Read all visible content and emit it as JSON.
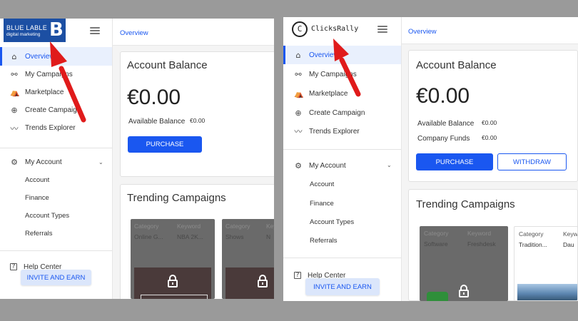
{
  "left": {
    "logo": {
      "line1": "BLUE LABLE",
      "line2": "digital marketing",
      "mark": "B"
    },
    "breadcrumb": "Overview",
    "nav": [
      "Overview",
      "My Campaigns",
      "Marketplace",
      "Create Campaign",
      "Trends Explorer"
    ],
    "account": {
      "label": "My Account",
      "items": [
        "Account",
        "Finance",
        "Account Types",
        "Referrals"
      ]
    },
    "help": "Help Center",
    "invite": "INVITE AND EARN",
    "balance_card": {
      "title": "Account Balance",
      "amount": "€0.00",
      "available_label": "Available Balance",
      "available_value": "€0.00",
      "purchase": "PURCHASE"
    },
    "trending": {
      "title": "Trending Campaigns",
      "cards": [
        {
          "col1_head": "Category",
          "col1_val": "Online G...",
          "col2_head": "Keyword",
          "col2_val": "NBA 2K..."
        },
        {
          "col1_head": "Category",
          "col1_val": "Shows",
          "col2_head": "Keyword",
          "col2_val": "N"
        }
      ]
    }
  },
  "right": {
    "logo": {
      "mark": "C",
      "text": "ClicksRally"
    },
    "breadcrumb": "Overview",
    "nav": [
      "Overview",
      "My Campaigns",
      "Marketplace",
      "Create Campaign",
      "Trends Explorer"
    ],
    "account": {
      "label": "My Account",
      "items": [
        "Account",
        "Finance",
        "Account Types",
        "Referrals"
      ]
    },
    "help": "Help Center",
    "invite": "INVITE AND EARN",
    "balance_card": {
      "title": "Account Balance",
      "amount": "€0.00",
      "available_label": "Available Balance",
      "available_value": "€0.00",
      "funds_label": "Company Funds",
      "funds_value": "€0.00",
      "purchase": "PURCHASE",
      "withdraw": "WITHDRAW"
    },
    "trending": {
      "title": "Trending Campaigns",
      "cards": [
        {
          "col1_head": "Category",
          "col1_val": "Software",
          "col2_head": "Keyword",
          "col2_val": "Freshdesk"
        },
        {
          "col1_head": "Category",
          "col1_val": "Tradition...",
          "col2_head": "Keyw",
          "col2_val": "Dau"
        }
      ]
    }
  },
  "icons": [
    "home-icon",
    "campaigns-icon",
    "marketplace-icon",
    "create-icon",
    "trends-icon",
    "gear-icon",
    "help-icon",
    "chevron-down-icon",
    "lock-icon",
    "menu-icon"
  ],
  "colors": {
    "accent": "#1a57f0",
    "logo_blue": "#1c4fa3",
    "arrow": "#e01b1b",
    "backdrop": "#9a9a9a"
  }
}
